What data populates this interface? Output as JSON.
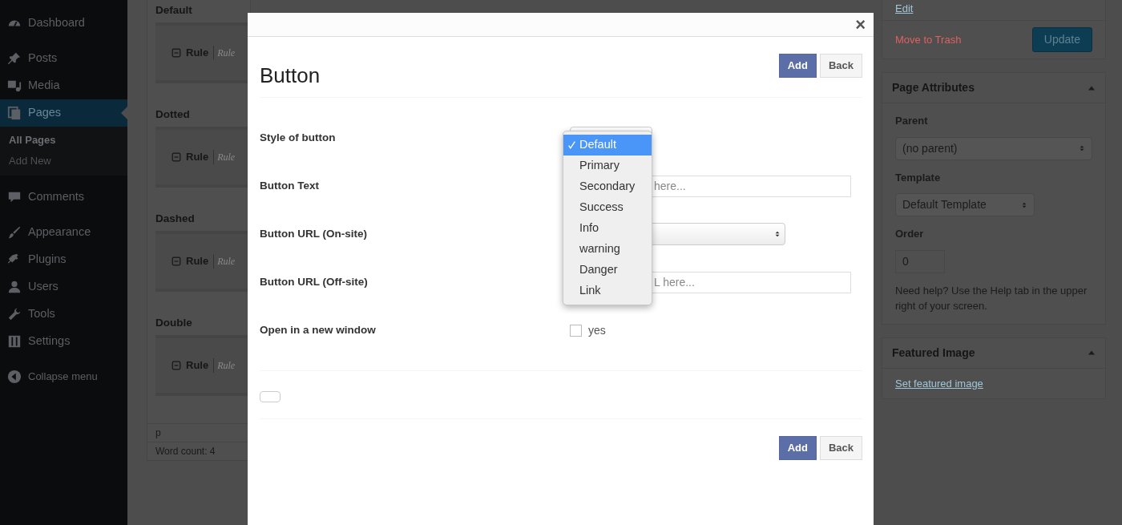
{
  "sidebar": {
    "items": [
      {
        "label": "Dashboard",
        "selected": false
      },
      {
        "label": "Posts",
        "selected": false
      },
      {
        "label": "Media",
        "selected": false
      },
      {
        "label": "Pages",
        "selected": true,
        "children": [
          {
            "label": "All Pages",
            "selected": true
          },
          {
            "label": "Add New",
            "selected": false
          }
        ]
      },
      {
        "label": "Comments",
        "selected": false
      },
      {
        "label": "Appearance",
        "selected": false
      },
      {
        "label": "Plugins",
        "selected": false
      },
      {
        "label": "Users",
        "selected": false
      },
      {
        "label": "Tools",
        "selected": false
      },
      {
        "label": "Settings",
        "selected": false
      }
    ],
    "collapse": "Collapse menu"
  },
  "editor": {
    "sections": [
      {
        "heading": "Default",
        "rule_label": "Rule",
        "rule_hint": "Rule"
      },
      {
        "heading": "Dotted",
        "rule_label": "Rule",
        "rule_hint": "Rule"
      },
      {
        "heading": "Dashed",
        "rule_label": "Rule",
        "rule_hint": "Rule"
      },
      {
        "heading": "Double",
        "rule_label": "Rule",
        "rule_hint": "Rule"
      }
    ],
    "path": "p",
    "word_count": "Word count: 4"
  },
  "publish": {
    "edit_link": "Edit",
    "trash_link": "Move to Trash",
    "update_button": "Update"
  },
  "page_attributes": {
    "title": "Page Attributes",
    "parent_label": "Parent",
    "parent_value": "(no parent)",
    "template_label": "Template",
    "template_value": "Default Template",
    "order_label": "Order",
    "order_value": "0",
    "help": "Need help? Use the Help tab in the upper right of your screen."
  },
  "featured_image": {
    "title": "Featured Image",
    "link": "Set featured image"
  },
  "modal": {
    "close": "×",
    "title": "Button",
    "buttons": [
      "Add",
      "Back"
    ],
    "fields": [
      {
        "kind": "select",
        "label": "Style of button"
      },
      {
        "kind": "text",
        "label": "Button Text",
        "placeholder": "here..."
      },
      {
        "kind": "select",
        "label": "Button URL (On-site)"
      },
      {
        "kind": "text",
        "label": "Button URL (Off-site)",
        "placeholder": "L here..."
      },
      {
        "kind": "checkbox",
        "label": "Open in a new window",
        "option": "yes",
        "checked": false
      }
    ],
    "dropdown": {
      "options": [
        {
          "label": "Default",
          "selected": true
        },
        {
          "label": "Primary",
          "selected": false
        },
        {
          "label": "Secondary",
          "selected": false
        },
        {
          "label": "Success",
          "selected": false
        },
        {
          "label": "Info",
          "selected": false
        },
        {
          "label": "warning",
          "selected": false
        },
        {
          "label": "Danger",
          "selected": false
        },
        {
          "label": "Link",
          "selected": false
        }
      ]
    },
    "footer_buttons": [
      "Add",
      "Back"
    ]
  }
}
